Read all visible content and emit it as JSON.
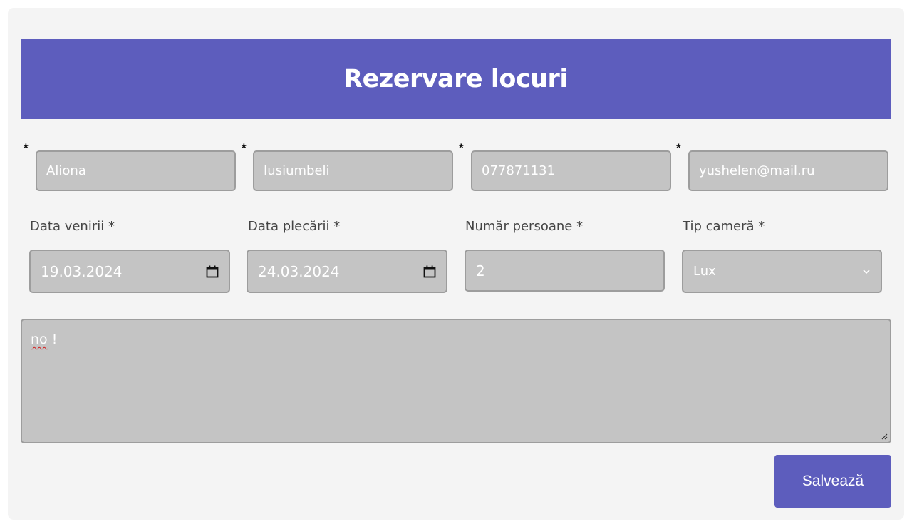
{
  "form": {
    "title": "Rezervare locuri",
    "required_mark": "*",
    "first_name": "Aliona",
    "last_name": "Iusiumbeli",
    "phone": "077871131",
    "email": "yushelen@mail.ru",
    "arrival": {
      "label": "Data venirii *",
      "value": "19.03.2024"
    },
    "departure": {
      "label": "Data plecării *",
      "value": "24.03.2024"
    },
    "persons": {
      "label": "Număr persoane *",
      "value": "2"
    },
    "room_type": {
      "label": "Tip cameră *",
      "value": "Lux"
    },
    "comment": {
      "word1": "no",
      "word2": " !"
    },
    "save_label": "Salvează"
  },
  "colors": {
    "accent": "#5d5dbd",
    "panel": "#f4f4f4",
    "field_bg": "#c4c4c4",
    "field_border": "#9d9d9d",
    "spellcheck": "#d32020"
  },
  "icons": {
    "date_picker": "calendar-icon",
    "select": "chevron-down-icon",
    "textarea_resize": "resize-handle-icon"
  }
}
